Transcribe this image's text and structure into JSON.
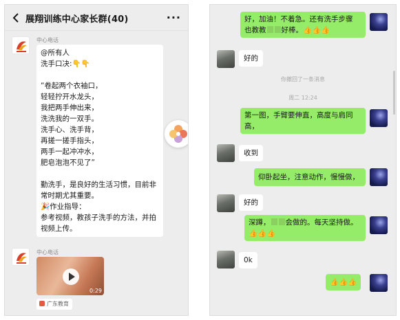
{
  "left_chat": {
    "title": "展翔训练中心家长群(40)",
    "more_label": "···",
    "messages": [
      {
        "sender": "中心电话",
        "lines": [
          "@所有人",
          "洗手口决:👇👇",
          "",
          "“卷起两个衣袖口，",
          "轻轻拧开水龙头，",
          "我把两手伸出来，",
          "洗洗我的一双手。",
          "洗手心、洗手背，",
          "再搓一搓手指头，",
          "两手一起冲冲水，",
          "肥皂泡泡不见了”",
          "",
          "勤洗手，是良好的生活习惯，目前非",
          "常时期尤其重要。",
          "🎉作业指导：",
          "参考视频，教孩子洗手的方法，并拍",
          "视频上传。"
        ]
      },
      {
        "sender": "中心电话",
        "video": {
          "duration": "0:29",
          "source": "广东教育"
        }
      }
    ]
  },
  "right_chat": {
    "msg1_line1": "好，加油！不着急。还有洗手步骤",
    "msg1_line2a": "也教教",
    "msg1_line2b": "好棒。👍👍👍",
    "msg2": "好的",
    "recall_notice": "你撤回了一条消息",
    "timestamp": "周二 12:24",
    "msg3_line1": "第一图，手臂要伸直，高度与肩同",
    "msg3_line2": "高，",
    "msg4": "收到",
    "msg5": "仰卧起坐，注意动作，慢慢做，",
    "msg6": "好的",
    "msg7_line1a": "深蹲，",
    "msg7_line1b": "会做的。每天坚持做。",
    "msg7_line2": "👍👍👍",
    "msg8": "0k",
    "msg9": "👍👍👍"
  }
}
